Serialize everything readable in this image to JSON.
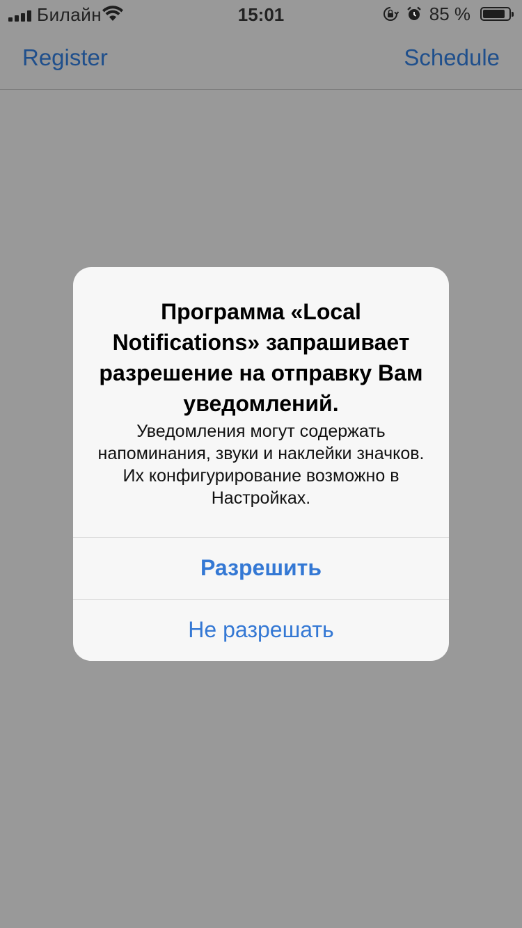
{
  "status_bar": {
    "carrier": "Билайн",
    "time": "15:01",
    "battery_percent_label": "85 %",
    "battery_level": 0.85,
    "icons": [
      "signal-icon",
      "wifi-icon",
      "rotation-lock-icon",
      "alarm-icon",
      "battery-icon"
    ]
  },
  "nav": {
    "left_label": "Register",
    "right_label": "Schedule"
  },
  "alert": {
    "title": "Программа «Local Notifications» запрашивает разрешение на отправку Вам уведомлений.",
    "message": "Уведомления могут содержать напоминания, звуки и наклейки значков. Их конфигурирование возможно в Настройках.",
    "allow_label": "Разрешить",
    "deny_label": "Не разрешать"
  },
  "colors": {
    "dimmed_background": "#999999",
    "nav_tint_dimmed": "#1f4f8c",
    "alert_button": "#3478d4",
    "alert_background": "#f7f7f7"
  }
}
